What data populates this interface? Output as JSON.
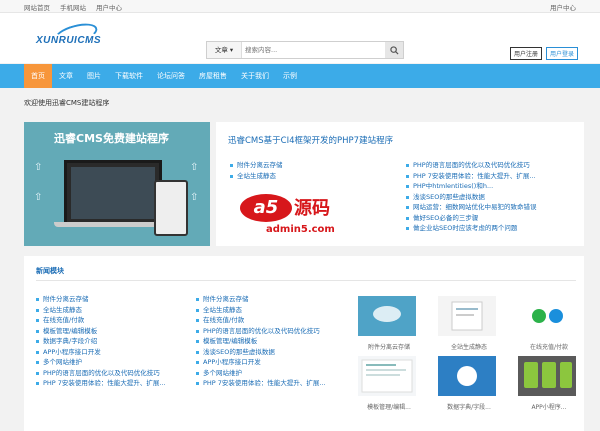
{
  "topbar": {
    "links": [
      "网站首页",
      "手机网站",
      "用户中心"
    ],
    "right": "用户中心"
  },
  "header": {
    "logo": "XUNRUICMS",
    "search": {
      "select": "文章",
      "placeholder": "搜索内容..."
    },
    "register": "用户注册",
    "login": "用户登录"
  },
  "nav": [
    "首页",
    "文章",
    "图片",
    "下载软件",
    "论坛问答",
    "房屋租售",
    "关于我们",
    "示例"
  ],
  "welcome": "欢迎使用迅睿CMS建站程序",
  "banner": {
    "title": "迅睿CMS免费建站程序"
  },
  "feature": {
    "title": "迅睿CMS基于CI4框架开发的PHP7建站程序",
    "left_list": [
      "附件分离云存储",
      "全站生成静态"
    ],
    "right_list": [
      "PHP的语言层面的优化以及代码优化技巧",
      "PHP 7安装使用体验：性能大提升、扩展...",
      "PHP中htmlentities()和h...",
      "浅谈SEO的那些虚拟数据",
      "网站运营：细数网站优化中易犯的致命错误",
      "做好SEO必备的三步骤",
      "做企业站SEO时应该考虑的两个问题"
    ],
    "ad": {
      "mark": "a5",
      "cn": "源码",
      "domain": "admin5.com"
    }
  },
  "news": {
    "title": "新闻模块",
    "col1": [
      "附件分离云存储",
      "全站生成静态",
      "在线充值/付款",
      "模板管理/编辑模板",
      "数据字典/字段介绍",
      "APP小程序接口开发",
      "多个网站维护",
      "PHP的语言层面的优化以及代码优化技巧",
      "PHP 7安装使用体验：性能大提升、扩展..."
    ],
    "col2": [
      "附件分离云存储",
      "全站生成静态",
      "在线充值/付款",
      "PHP的语言层面的优化以及代码优化技巧",
      "模板管理/编辑模板",
      "浅谈SEO的那些虚拟数据",
      "APP小程序接口开发",
      "多个网站维护",
      "PHP 7安装使用体验：性能大提升、扩展..."
    ],
    "thumbs": [
      {
        "caption": "附件分离云存储"
      },
      {
        "caption": "全站生成静态"
      },
      {
        "caption": "在线充值/付款"
      },
      {
        "caption": "模板管理/编辑..."
      },
      {
        "caption": "数据字典/字段..."
      },
      {
        "caption": "APP小程序..."
      }
    ]
  },
  "colors": {
    "nav": "#3cabe8",
    "nav_active": "#f7963b",
    "link": "#1a6cb5",
    "ad_red": "#d7171b",
    "banner": "#63aab7"
  }
}
